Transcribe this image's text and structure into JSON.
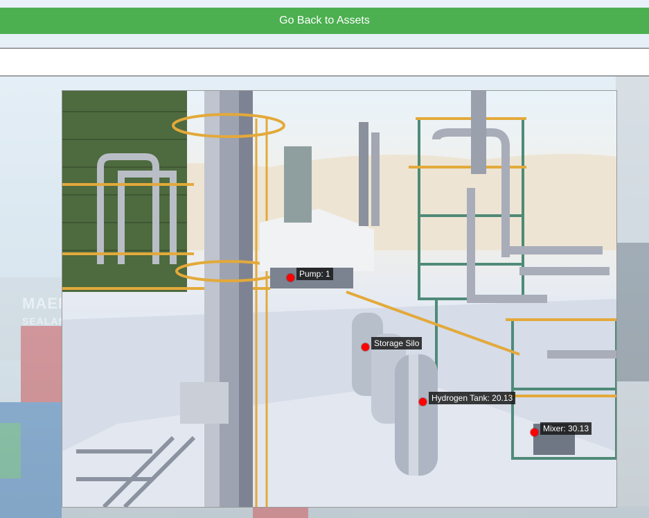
{
  "header": {
    "back_button_label": "Go Back to Assets"
  },
  "scene": {
    "background_logo_text": "MAERSK",
    "background_logo_subtext": "SEALAND",
    "markers": [
      {
        "label": "Pump: 1"
      },
      {
        "label": "Storage Silo"
      },
      {
        "label": "Hydrogen Tank: 20.13"
      },
      {
        "label": "Mixer: 30.13"
      }
    ]
  },
  "colors": {
    "button_green": "#4caf50",
    "marker_red": "#ff0000"
  }
}
